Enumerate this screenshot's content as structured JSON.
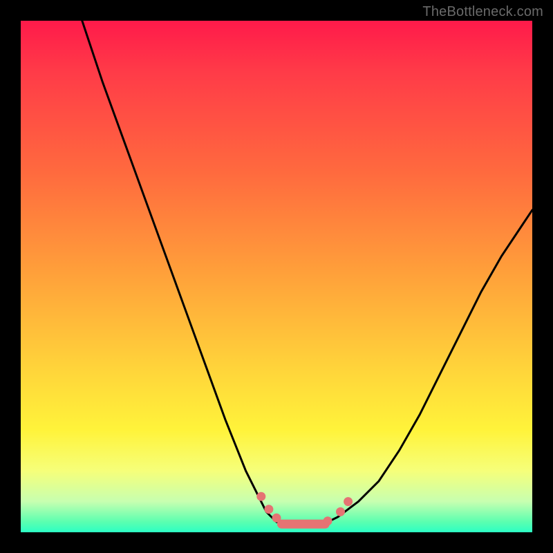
{
  "attribution": "TheBottleneck.com",
  "colors": {
    "frame": "#000000",
    "gradient_top": "#ff1a4a",
    "gradient_mid": "#ffd43a",
    "gradient_bottom": "#2cffc4",
    "curve_stroke": "#000000",
    "marker_fill": "#e57373",
    "marker_stroke": "#c85a5a"
  },
  "chart_data": {
    "type": "line",
    "title": "",
    "xlabel": "",
    "ylabel": "",
    "xlim": [
      0,
      100
    ],
    "ylim": [
      0,
      100
    ],
    "series": [
      {
        "name": "left-branch",
        "x": [
          12,
          16,
          20,
          24,
          28,
          32,
          36,
          40,
          44,
          48,
          50
        ],
        "y": [
          100,
          88,
          77,
          66,
          55,
          44,
          33,
          22,
          12,
          4,
          2
        ]
      },
      {
        "name": "right-branch",
        "x": [
          60,
          62,
          66,
          70,
          74,
          78,
          82,
          86,
          90,
          94,
          98,
          100
        ],
        "y": [
          2,
          3,
          6,
          10,
          16,
          23,
          31,
          39,
          47,
          54,
          60,
          63
        ]
      },
      {
        "name": "floor",
        "x": [
          50,
          52,
          54,
          56,
          58,
          60
        ],
        "y": [
          2,
          1.5,
          1.5,
          1.5,
          1.5,
          2
        ]
      }
    ],
    "markers": [
      {
        "x": 47,
        "y": 7
      },
      {
        "x": 48.5,
        "y": 4.5
      },
      {
        "x": 50,
        "y": 2.8
      },
      {
        "x": 52,
        "y": 1.6
      },
      {
        "x": 54,
        "y": 1.6
      },
      {
        "x": 56,
        "y": 1.6
      },
      {
        "x": 58,
        "y": 1.6
      },
      {
        "x": 60,
        "y": 2.2
      },
      {
        "x": 62.5,
        "y": 4
      },
      {
        "x": 64,
        "y": 6
      }
    ],
    "marker_style": "thick-pill"
  }
}
